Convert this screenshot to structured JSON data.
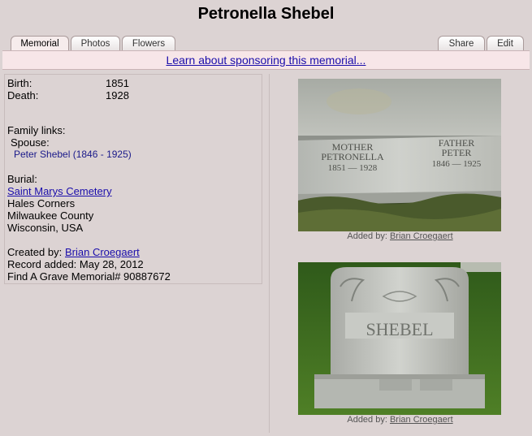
{
  "page": {
    "title": "Petronella Shebel"
  },
  "tabs": {
    "memorial": "Memorial",
    "photos": "Photos",
    "flowers": "Flowers",
    "share": "Share",
    "edit": "Edit"
  },
  "sponsor": {
    "link": "Learn about sponsoring this memorial..."
  },
  "details": {
    "birth_label": "Birth:",
    "birth_value": "1851",
    "death_label": "Death:",
    "death_value": "1928",
    "family_links_label": "Family links:",
    "spouse_label": "Spouse:",
    "spouse_link": "Peter Shebel (1846 - 1925)",
    "burial_label": "Burial:",
    "cemetery_link": "Saint Marys Cemetery",
    "city": "Hales Corners",
    "county": "Milwaukee County",
    "state_country": "Wisconsin, USA",
    "created_by_label": "Created by:",
    "created_by_link": "Brian Croegaert",
    "record_added": "Record added: May 28, 2012",
    "memorial_number": "Find A Grave Memorial# 90887672"
  },
  "photos": [
    {
      "added_by_label": "Added by:",
      "added_by_link": "Brian Croegaert",
      "inscription": {
        "left_line1": "MOTHER",
        "left_line2": "PETRONELLA",
        "left_line3": "1851 — 1928",
        "right_line1": "FATHER",
        "right_line2": "PETER",
        "right_line3": "1846 — 1925"
      }
    },
    {
      "added_by_label": "Added by:",
      "added_by_link": "Brian Croegaert",
      "inscription": {
        "family_name": "SHEBEL"
      }
    }
  ],
  "colors": {
    "background": "#dcd3d3",
    "sponsor_bar": "#f7e6e8",
    "link": "#1a0dab"
  }
}
